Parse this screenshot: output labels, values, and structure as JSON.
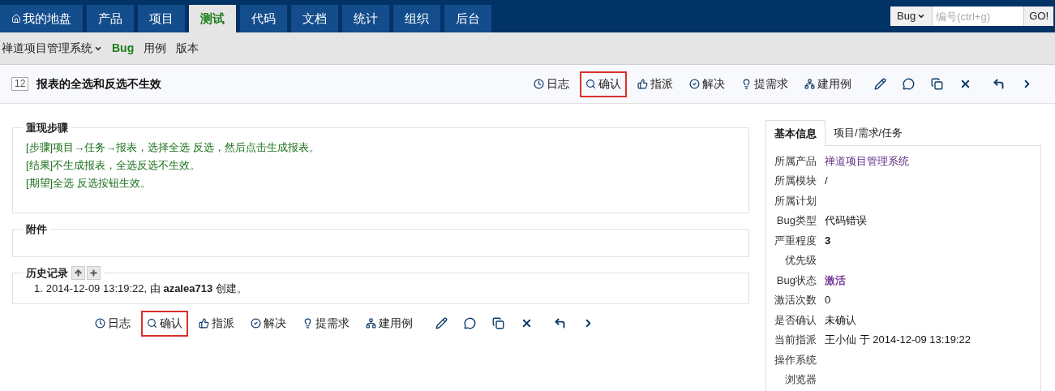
{
  "nav": {
    "tabs": [
      {
        "label": "我的地盘",
        "kind": "home",
        "selected": false
      },
      {
        "label": "产品",
        "kind": "plain",
        "selected": false
      },
      {
        "label": "项目",
        "kind": "plain",
        "selected": false
      },
      {
        "label": "测试",
        "kind": "plain",
        "selected": true
      },
      {
        "label": "代码",
        "kind": "plain",
        "selected": false
      },
      {
        "label": "文档",
        "kind": "plain",
        "selected": false
      },
      {
        "label": "统计",
        "kind": "plain",
        "selected": false
      },
      {
        "label": "组织",
        "kind": "plain",
        "selected": false
      },
      {
        "label": "后台",
        "kind": "plain",
        "selected": false
      }
    ],
    "search": {
      "type": "Bug",
      "placeholder": "编号(ctrl+g)",
      "button": "GO!"
    }
  },
  "subnav": {
    "product": "禅道项目管理系统",
    "items": [
      {
        "label": "Bug",
        "selected": true
      },
      {
        "label": "用例",
        "selected": false
      },
      {
        "label": "版本",
        "selected": false
      }
    ]
  },
  "bug": {
    "id": "12",
    "title": "报表的全选和反选不生效"
  },
  "toolbars": [
    {
      "actions": [
        {
          "kind": "log",
          "label": "日志",
          "highlighted": false
        },
        {
          "kind": "confirm",
          "label": "确认",
          "highlighted": true
        },
        {
          "kind": "assign",
          "label": "指派",
          "highlighted": false
        },
        {
          "kind": "resolve",
          "label": "解决",
          "highlighted": false
        },
        {
          "kind": "story",
          "label": "提需求",
          "highlighted": false
        },
        {
          "kind": "case",
          "label": "建用例",
          "highlighted": false
        },
        {
          "kind": "edit",
          "highlighted": false
        },
        {
          "kind": "comment",
          "highlighted": false
        },
        {
          "kind": "copy",
          "highlighted": false
        },
        {
          "kind": "delete",
          "highlighted": false
        },
        {
          "kind": "back",
          "highlighted": false
        },
        {
          "kind": "next",
          "highlighted": false
        }
      ]
    },
    {
      "actions": [
        {
          "kind": "log",
          "label": "日志",
          "highlighted": false
        },
        {
          "kind": "confirm",
          "label": "确认",
          "highlighted": true
        },
        {
          "kind": "assign",
          "label": "指派",
          "highlighted": false
        },
        {
          "kind": "resolve",
          "label": "解决",
          "highlighted": false
        },
        {
          "kind": "story",
          "label": "提需求",
          "highlighted": false
        },
        {
          "kind": "case",
          "label": "建用例",
          "highlighted": false
        },
        {
          "kind": "edit",
          "highlighted": false
        },
        {
          "kind": "comment",
          "highlighted": false
        },
        {
          "kind": "copy",
          "highlighted": false
        },
        {
          "kind": "delete",
          "highlighted": false
        },
        {
          "kind": "back",
          "highlighted": false
        },
        {
          "kind": "next",
          "highlighted": false
        }
      ]
    }
  ],
  "steps": {
    "title": "重现步骤",
    "lines": [
      "[步骤]项目→任务→报表，选择全选 反选，然后点击生成报表。",
      "[结果]不生成报表，全选反选不生效。",
      "[期望]全选 反选按钮生效。"
    ]
  },
  "attachments": {
    "title": "附件"
  },
  "history": {
    "title": "历史记录",
    "entries": [
      {
        "number": "1.",
        "text": "2014-12-09 13:19:22, 由 **azalea713** 创建。"
      }
    ]
  },
  "sidebar": {
    "tabs": [
      {
        "label": "基本信息",
        "selected": true
      },
      {
        "label": "项目/需求/任务",
        "selected": false
      }
    ],
    "fields": [
      {
        "label": "所属产品",
        "value": "禅道项目管理系统",
        "kind": "link"
      },
      {
        "label": "所属模块",
        "value": "/",
        "kind": "plain"
      },
      {
        "label": "所属计划"
      },
      {
        "label": "Bug类型",
        "value": "代码错误",
        "kind": "plain"
      },
      {
        "label": "严重程度",
        "value": "3",
        "kind": "strong"
      },
      {
        "label": "优先级"
      },
      {
        "label": "Bug状态",
        "value": "激活",
        "kind": "status"
      },
      {
        "label": "激活次数",
        "value": "0",
        "kind": "plain"
      },
      {
        "label": "是否确认",
        "value": "未确认",
        "kind": "plain"
      },
      {
        "label": "当前指派",
        "value": "王小仙 于 2014-12-09 13:19:22",
        "kind": "plain"
      },
      {
        "label": "操作系统"
      },
      {
        "label": "浏览器"
      }
    ]
  }
}
